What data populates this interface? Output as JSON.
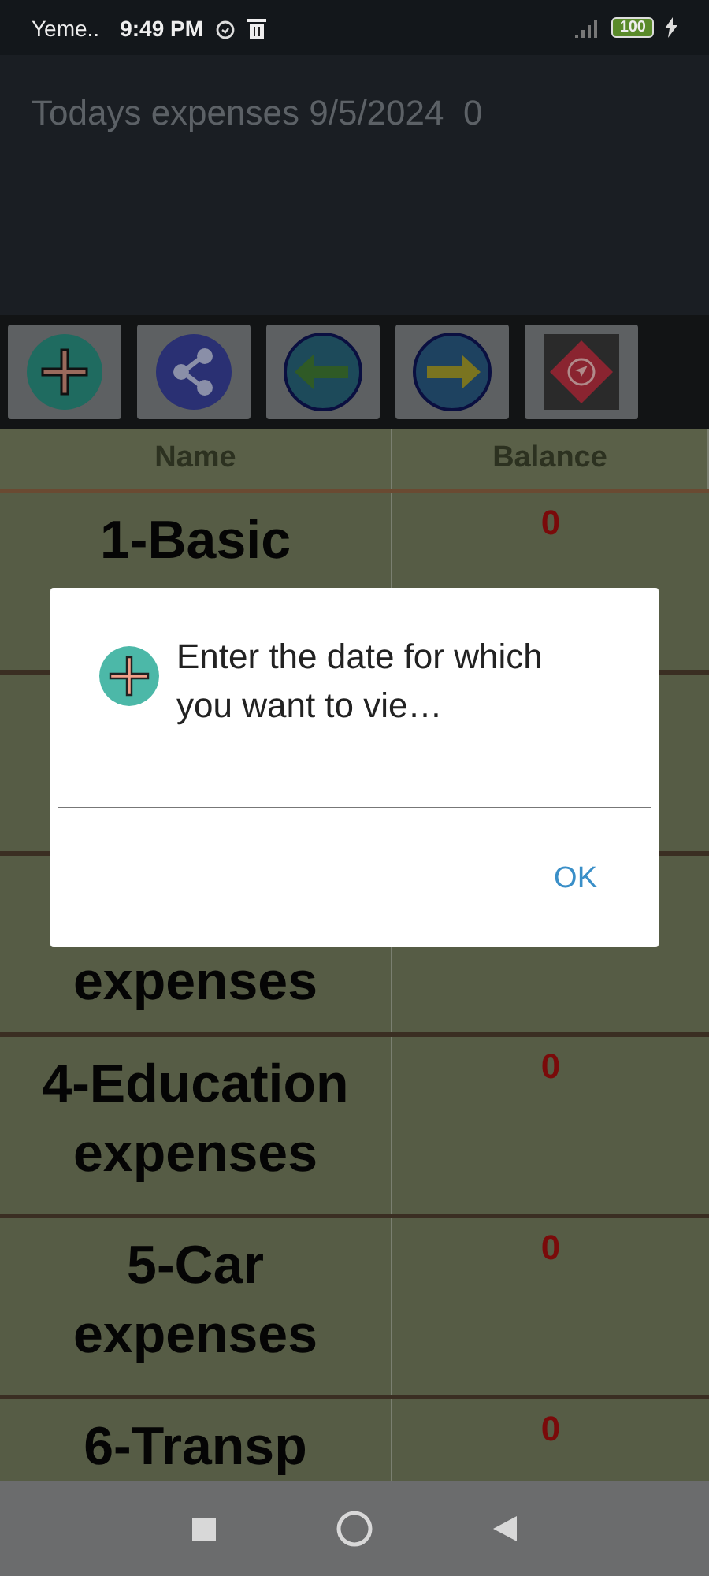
{
  "status_bar": {
    "carrier": "Yeme..",
    "time": "9:49 PM",
    "battery": "100"
  },
  "header": {
    "title": "Todays expenses 9/5/2024  0"
  },
  "toolbar": [
    {
      "kind": "add"
    },
    {
      "kind": "share"
    },
    {
      "kind": "back"
    },
    {
      "kind": "forward"
    },
    {
      "kind": "navigate"
    }
  ],
  "table": {
    "columns": [
      "Name",
      "Balance"
    ],
    "rows": [
      {
        "name": "1-Basic",
        "balance": "0"
      },
      {},
      {
        "name_tail": "expenses"
      },
      {
        "name": "4-Education expenses",
        "balance": "0"
      },
      {
        "name": "5-Car expenses",
        "balance": "0"
      },
      {
        "name": "6-Transp",
        "balance": "0"
      }
    ]
  },
  "dialog": {
    "title": "Enter the date for which you want to vie…",
    "button": "OK"
  }
}
